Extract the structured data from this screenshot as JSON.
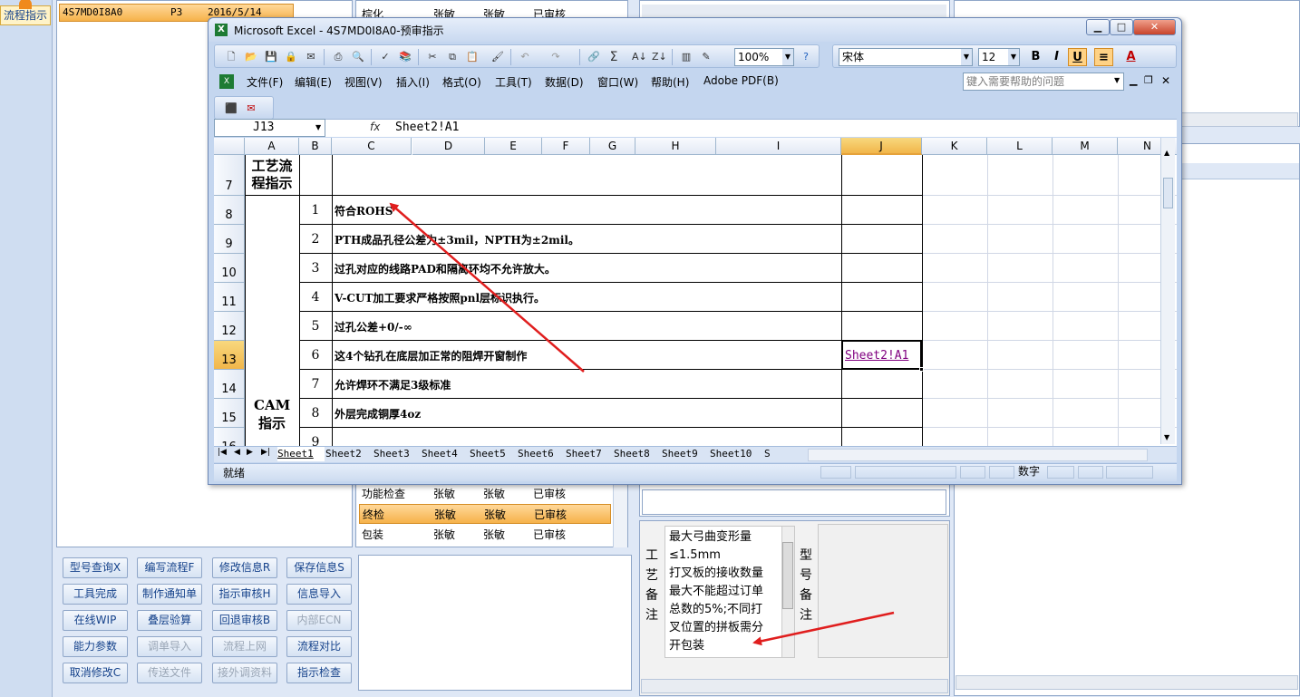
{
  "left_tab": {
    "label": "流程指示"
  },
  "bg_list": {
    "selected_row": {
      "code": "4S7MD0I8A0",
      "rev": "P3",
      "date": "2016/5/14"
    }
  },
  "bg_process": {
    "top_row": [
      "棕化",
      "张敏",
      "张敏",
      "已审核"
    ],
    "rows": [
      [
        "功能检查",
        "张敏",
        "张敏",
        "已审核"
      ],
      [
        "终检",
        "张敏",
        "张敏",
        "已审核"
      ],
      [
        "包装",
        "张敏",
        "张敏",
        "已审核"
      ]
    ]
  },
  "buttons": [
    [
      "型号查询X",
      "编写流程F",
      "修改信息R",
      "保存信息S"
    ],
    [
      "工具完成",
      "制作通知单",
      "指示审核H",
      "信息导入"
    ],
    [
      "在线WIP",
      "叠层验算",
      "回退审核B",
      "内部ECN"
    ],
    [
      "能力参数",
      "调单导入",
      "流程上网",
      "流程对比"
    ],
    [
      "取消修改C",
      "传送文件",
      "接外调资料",
      "指示检查"
    ]
  ],
  "process_note": {
    "label": "工艺备注",
    "lines": [
      "最大弓曲变形量",
      "≤1.5mm",
      "打叉板的接收数量",
      "最大不能超过订单",
      "总数的5%;不同打",
      "叉位置的拼板需分",
      "开包装"
    ]
  },
  "model_note": {
    "label": "型号备注"
  },
  "excel": {
    "title": "Microsoft Excel - 4S7MD0I8A0-预审指示",
    "zoom": "100%",
    "font": "宋体",
    "font_size": "12",
    "menus": [
      "文件(F)",
      "编辑(E)",
      "视图(V)",
      "插入(I)",
      "格式(O)",
      "工具(T)",
      "数据(D)",
      "窗口(W)",
      "帮助(H)",
      "Adobe PDF(B)"
    ],
    "help_placeholder": "键入需要帮助的问题",
    "name_box": "J13",
    "formula": "Sheet2!A1",
    "columns": [
      "A",
      "B",
      "C",
      "D",
      "E",
      "F",
      "G",
      "H",
      "I",
      "J",
      "K",
      "L",
      "M",
      "N"
    ],
    "rows": [
      "7",
      "8",
      "9",
      "10",
      "11",
      "12",
      "13",
      "14",
      "15",
      "16"
    ],
    "section1": "工艺流程指示",
    "section2": "CAM指示",
    "items": [
      {
        "num": "1",
        "text": "符合ROHS"
      },
      {
        "num": "2",
        "text": "PTH成品孔径公差为±3mil，NPTH为±2mil。"
      },
      {
        "num": "3",
        "text": "过孔对应的线路PAD和隔离环均不允许放大。"
      },
      {
        "num": "4",
        "text": "V-CUT加工要求严格按照pnl层标识执行。"
      },
      {
        "num": "5",
        "text": "过孔公差+0/-∞"
      },
      {
        "num": "6",
        "text": "这4个钻孔在底层加正常的阻焊开窗制作"
      },
      {
        "num": "7",
        "text": "允许焊环不满足3级标准"
      },
      {
        "num": "8",
        "text": "外层完成铜厚4oz"
      },
      {
        "num": "9",
        "text": ""
      }
    ],
    "link_cell": "Sheet2!A1",
    "sheets": [
      "Sheet1",
      "Sheet2",
      "Sheet3",
      "Sheet4",
      "Sheet5",
      "Sheet6",
      "Sheet7",
      "Sheet8",
      "Sheet9",
      "Sheet10",
      "S"
    ],
    "status": "就绪",
    "status_right": "数字"
  },
  "colors": {
    "arrow": "#e01e1e",
    "title_bar": "#c9d9f0",
    "selected": "#f6b24a"
  }
}
